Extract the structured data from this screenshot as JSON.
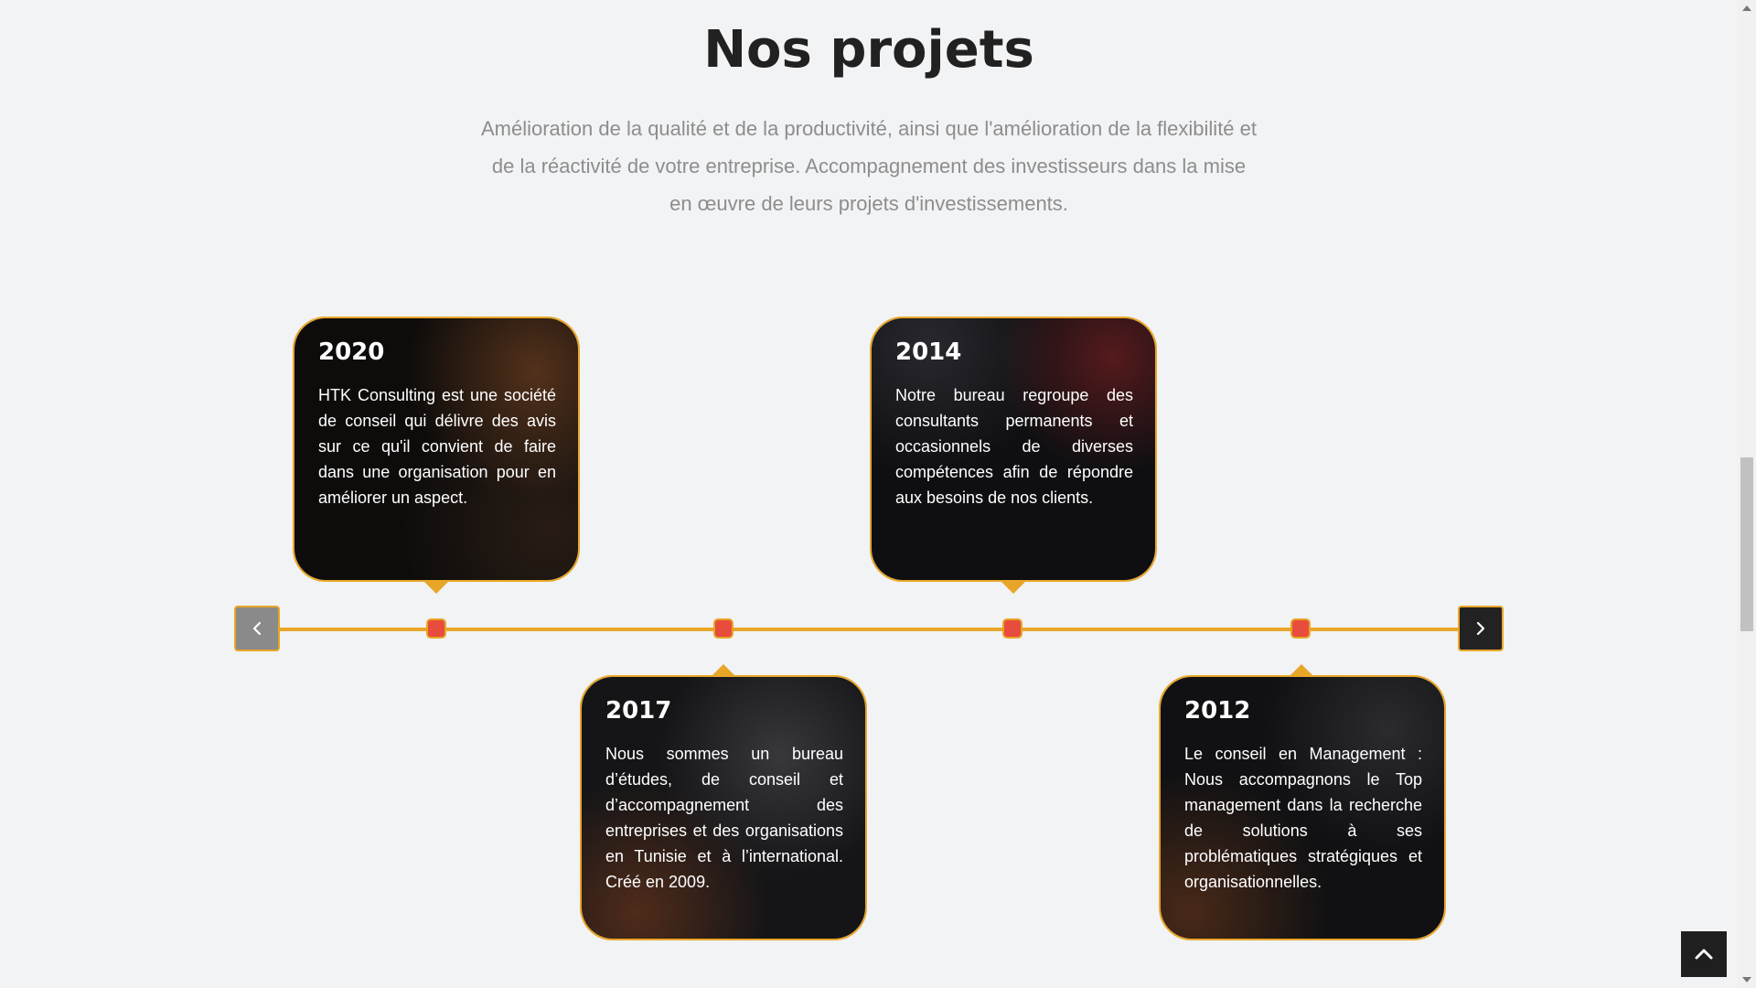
{
  "section": {
    "title": "Nos projets",
    "subtitle_lines": [
      "Amélioration de la qualité et de la productivité, ainsi que l'amélioration de la flexibilité et",
      "de la réactivité de votre entreprise. Accompagnement des investisseurs dans la mise",
      "en œuvre de leurs projets d'investissements."
    ]
  },
  "timeline": {
    "cards": [
      {
        "year": "2020",
        "text": "HTK Consulting est une société de conseil qui délivre des avis sur ce qu'il convient de faire dans une organisation pour en améliorer un aspect."
      },
      {
        "year": "2017",
        "text": "Nous sommes un bureau d’études, de conseil et d’accompagnement des entreprises et des organisations en Tunisie et à l’international. Créé en 2009."
      },
      {
        "year": "2014",
        "text": "Notre bureau regroupe des consultants permanents et occasionnels de diverses compétences afin de répondre aux besoins de nos clients."
      },
      {
        "year": "2012",
        "text": "Le conseil en Management : Nous accompagnons le Top management dans la recherche de solutions à ses problématiques stratégiques et organisationnelles."
      }
    ],
    "prev_icon": "chevron-left-icon",
    "next_icon": "chevron-right-icon"
  },
  "scroll_top_icon": "chevron-up-icon",
  "colors": {
    "accent": "#e8a628",
    "node": "#e84c3d",
    "background": "#f2f3f5",
    "card_bg": "#111111"
  }
}
